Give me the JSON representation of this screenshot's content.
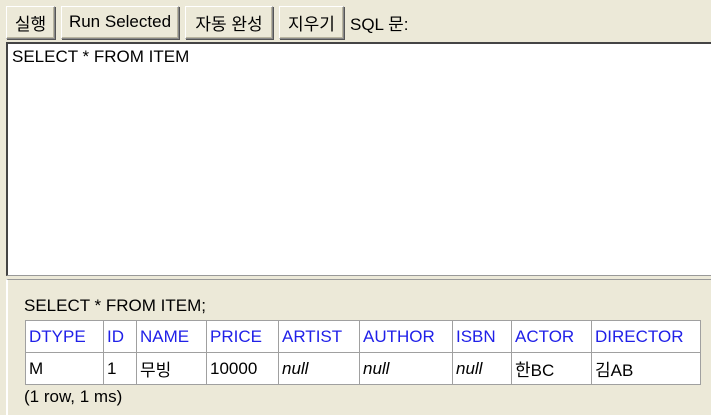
{
  "toolbar": {
    "run_label": "실행",
    "run_selected_label": "Run Selected",
    "autocomplete_label": "자동 완성",
    "clear_label": "지우기",
    "sql_label": "SQL 문:"
  },
  "editor": {
    "value": "SELECT * FROM ITEM"
  },
  "result": {
    "query": "SELECT * FROM ITEM;",
    "columns": [
      "DTYPE",
      "ID",
      "NAME",
      "PRICE",
      "ARTIST",
      "AUTHOR",
      "ISBN",
      "ACTOR",
      "DIRECTOR"
    ],
    "rows": [
      [
        "M",
        "1",
        "무빙",
        "10000",
        "null",
        "null",
        "null",
        "한BC",
        "김AB"
      ]
    ],
    "summary": "(1 row, 1 ms)"
  }
}
